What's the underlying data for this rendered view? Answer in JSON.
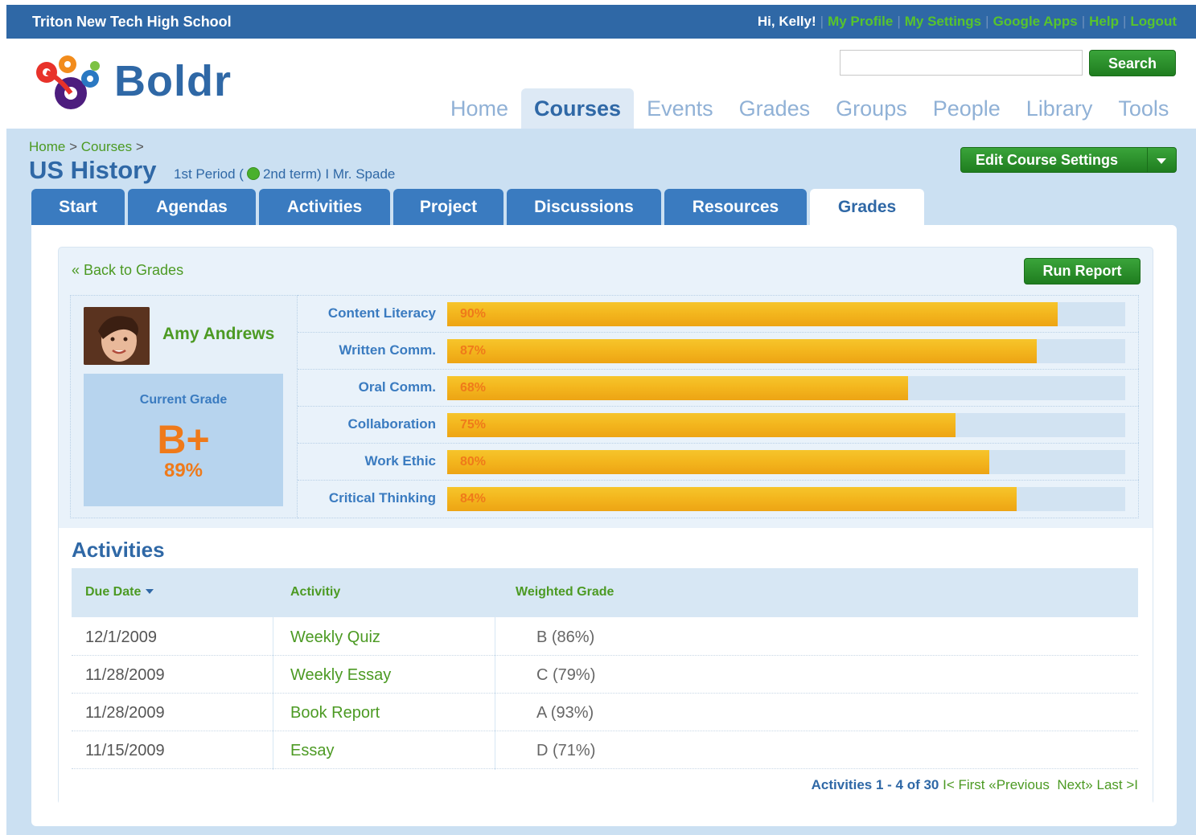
{
  "topbar": {
    "school": "Triton New Tech High School",
    "greeting": "Hi, Kelly!",
    "links": [
      "My Profile",
      "My Settings",
      "Google Apps",
      "Help",
      "Logout"
    ]
  },
  "header": {
    "logo": "Boldr",
    "search_placeholder": "",
    "search_button": "Search",
    "nav": [
      "Home",
      "Courses",
      "Events",
      "Grades",
      "Groups",
      "People",
      "Library",
      "Tools"
    ],
    "active_nav": "Courses"
  },
  "course": {
    "breadcrumb": [
      "Home",
      "Courses"
    ],
    "title": "US History",
    "period": "1st Period (",
    "term": "2nd term)",
    "teacher_sep": "I",
    "teacher": "Mr. Spade",
    "edit_button": "Edit Course Settings",
    "tabs": [
      "Start",
      "Agendas",
      "Activities",
      "Project",
      "Discussions",
      "Resources",
      "Grades"
    ],
    "active_tab": "Grades"
  },
  "grades": {
    "back_link": "« Back to Grades",
    "run_report": "Run Report",
    "student_name": "Amy Andrews",
    "current_grade_label": "Current Grade",
    "current_grade_letter": "B+",
    "current_grade_pct": "89%",
    "skills": [
      {
        "label": "Content Literacy",
        "pct_text": "90%",
        "value": 0.9
      },
      {
        "label": "Written Comm.",
        "pct_text": "87%",
        "value": 0.87
      },
      {
        "label": "Oral Comm.",
        "pct_text": "68%",
        "value": 0.68
      },
      {
        "label": "Collaboration",
        "pct_text": "75%",
        "value": 0.75
      },
      {
        "label": "Work Ethic",
        "pct_text": "80%",
        "value": 0.8
      },
      {
        "label": "Critical Thinking",
        "pct_text": "84%",
        "value": 0.84
      }
    ]
  },
  "activities": {
    "title": "Activities",
    "headers": [
      "Due Date",
      "Activitiy",
      "Weighted Grade"
    ],
    "rows": [
      {
        "date": "12/1/2009",
        "name": "Weekly Quiz",
        "grade": "B (86%)"
      },
      {
        "date": "11/28/2009",
        "name": "Weekly Essay",
        "grade": "C (79%)"
      },
      {
        "date": "11/28/2009",
        "name": "Book Report",
        "grade": "A (93%)"
      },
      {
        "date": "11/15/2009",
        "name": "Essay",
        "grade": "D (71%)"
      }
    ],
    "pager": {
      "count": "Activities 1 - 4 of 30",
      "first": "I< First",
      "prev": "«Previous",
      "next": "Next»",
      "last": "Last >I"
    }
  },
  "colors": {
    "brand_blue": "#2f68a6",
    "link_green": "#4c9a23",
    "button_green": "#2a922a",
    "bar_orange": "#f3b51d",
    "grade_orange": "#ef7a1a"
  }
}
